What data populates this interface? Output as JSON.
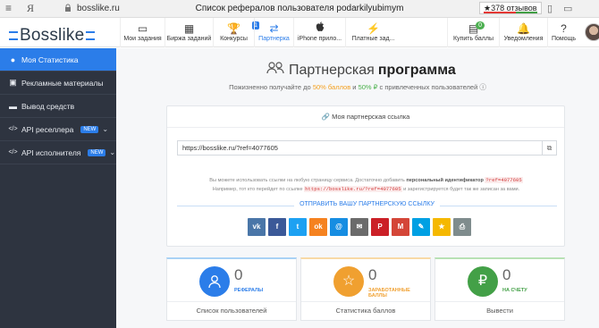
{
  "browser": {
    "menu_glyph": "≡",
    "yandex_glyph": "Я",
    "url": "bosslike.ru",
    "page_title": "Список рефералов пользователя podarkilyubimym",
    "reviews": "★378 отзывов",
    "icons": [
      "bookmark-icon",
      "comment-icon"
    ]
  },
  "header": {
    "logo": "Bosslike",
    "nav": [
      {
        "label": "Мои задания",
        "icon": "monitor-icon",
        "glyph": "▭"
      },
      {
        "label": "Биржа заданий",
        "icon": "grid-icon",
        "glyph": "▦"
      },
      {
        "label": "Конкурсы",
        "icon": "trophy-icon",
        "glyph": "🏆",
        "badge": "1"
      },
      {
        "label": "Партнерка",
        "icon": "handshake-icon",
        "glyph": "⇄"
      },
      {
        "label": "iPhone прило...",
        "icon": "apple-icon",
        "glyph": ""
      },
      {
        "label": "Платные зад...",
        "icon": "lightning-icon",
        "glyph": "⚡"
      },
      {
        "label": "Купить баллы",
        "icon": "wallet-icon",
        "glyph": "▤",
        "badge": "0"
      },
      {
        "label": "Уведомления",
        "icon": "bell-icon",
        "glyph": "🔔"
      },
      {
        "label": "Помощь",
        "icon": "help-icon",
        "glyph": "?"
      }
    ]
  },
  "sidebar": {
    "items": [
      {
        "label": "Моя Статистика",
        "icon": "user-icon",
        "glyph": "👤"
      },
      {
        "label": "Рекламные материалы",
        "icon": "image-icon",
        "glyph": "▣"
      },
      {
        "label": "Вывод средств",
        "icon": "card-icon",
        "glyph": "▬"
      },
      {
        "label": "API реселлера",
        "icon": "code-icon",
        "glyph": "</>",
        "badge": "NEW"
      },
      {
        "label": "API исполнителя",
        "icon": "code-icon",
        "glyph": "</>",
        "badge": "NEW"
      }
    ]
  },
  "main": {
    "title_light": "Партнерская",
    "title_bold": "программа",
    "subtitle_a": "Пожизненно получайте до ",
    "subtitle_b": "50% баллов",
    "subtitle_c": " и ",
    "subtitle_d": "50% ₽",
    "subtitle_e": " с привлеченных пользователей ⓘ",
    "card_head": "🔗 Моя партнерская ссылка",
    "ref_link": "https://bosslike.ru/?ref=4077605",
    "info_1a": "Вы можете использовать ссылки на любую страницу сервиса. Достаточно добавить ",
    "info_1b": "персональный идентификатор",
    "info_1c": "?ref=4077605",
    "info_2a": "Например, тот кто перейдет по ссылке ",
    "info_2b": "https://bosslike.ru/?ref=4077605",
    "info_2c": " и зарегистрируется будет так же записан за вами.",
    "send_label": "ОТПРАВИТЬ ВАШУ ПАРТНЕРСКУЮ ССЫЛКУ",
    "socials": [
      {
        "name": "vk-share-button",
        "glyph": "vk",
        "color": "#4a76a8"
      },
      {
        "name": "facebook-share-button",
        "glyph": "f",
        "color": "#3b5998"
      },
      {
        "name": "twitter-share-button",
        "glyph": "t",
        "color": "#1da1f2"
      },
      {
        "name": "odnoklassniki-share-button",
        "glyph": "ok",
        "color": "#f58220"
      },
      {
        "name": "mailru-share-button",
        "glyph": "@",
        "color": "#168de2"
      },
      {
        "name": "email-share-button",
        "glyph": "✉",
        "color": "#6b6b6b"
      },
      {
        "name": "pinterest-share-button",
        "glyph": "P",
        "color": "#cb2027"
      },
      {
        "name": "gmail-share-button",
        "glyph": "M",
        "color": "#d44638"
      },
      {
        "name": "livejournal-share-button",
        "glyph": "✎",
        "color": "#00a0e3"
      },
      {
        "name": "favorite-share-button",
        "glyph": "★",
        "color": "#f5b800"
      },
      {
        "name": "print-share-button",
        "glyph": "⎙",
        "color": "#7f8c8d"
      }
    ],
    "stats": [
      {
        "value": "0",
        "caption": "РЕФЕРАЛЫ",
        "footer": "Список пользователей",
        "color": "#2b7de9",
        "caption_color": "#2b7de9",
        "icon": "user-icon",
        "glyph": "👤"
      },
      {
        "value": "0",
        "caption": "ЗАРАБОТАННЫЕ БАЛЛЫ",
        "footer": "Статистика баллов",
        "color": "#f0a030",
        "caption_color": "#f0a030",
        "icon": "star-icon",
        "glyph": "☆"
      },
      {
        "value": "0",
        "caption": "НА СЧЕТУ",
        "footer": "Вывести",
        "color": "#43a047",
        "caption_color": "#43a047",
        "icon": "ruble-icon",
        "glyph": "₽"
      }
    ]
  }
}
